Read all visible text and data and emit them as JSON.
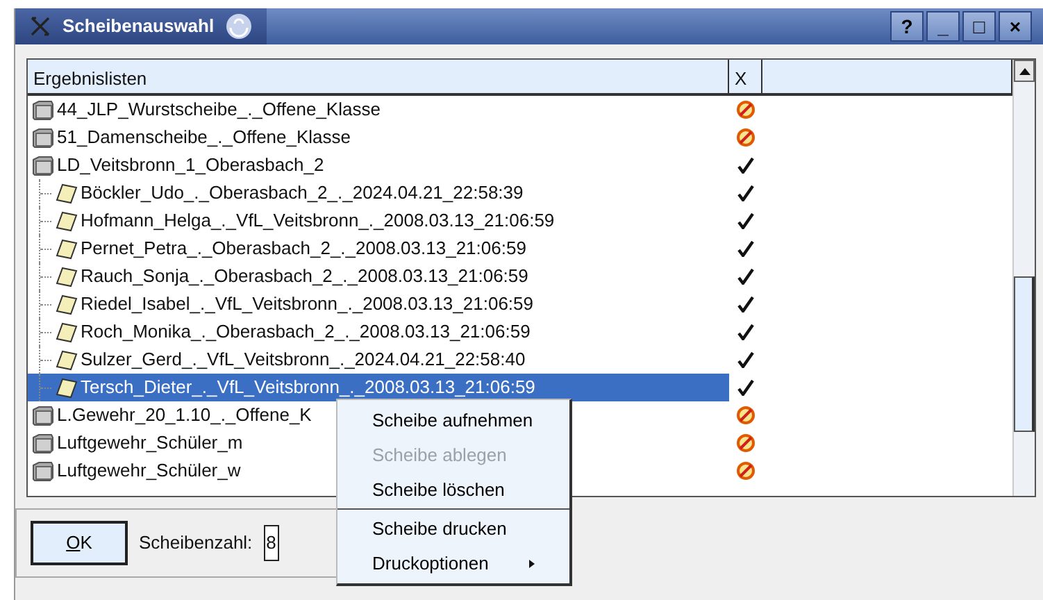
{
  "window": {
    "title": "Scheibenauswahl",
    "buttons": [
      "?",
      "_",
      "□",
      "×"
    ]
  },
  "table": {
    "columns": [
      "Ergebnislisten",
      "X"
    ],
    "rows": [
      {
        "label": "44_JLP_Wurstscheibe_._Offene_Klasse",
        "kind": "folder",
        "passed": false,
        "selected": false
      },
      {
        "label": "51_Damenscheibe_._Offene_Klasse",
        "kind": "folder",
        "passed": false,
        "selected": false
      },
      {
        "label": "LD_Veitsbronn_1_Oberasbach_2",
        "kind": "folder",
        "passed": true,
        "selected": false,
        "children": [
          {
            "label": "Böckler_Udo_._Oberasbach_2_._2024.04.21_22:58:39",
            "kind": "target",
            "passed": true,
            "selected": false
          },
          {
            "label": "Hofmann_Helga_._VfL_Veitsbronn_._2008.03.13_21:06:59",
            "kind": "target",
            "passed": true,
            "selected": false
          },
          {
            "label": "Pernet_Petra_._Oberasbach_2_._2008.03.13_21:06:59",
            "kind": "target",
            "passed": true,
            "selected": false
          },
          {
            "label": "Rauch_Sonja_._Oberasbach_2_._2008.03.13_21:06:59",
            "kind": "target",
            "passed": true,
            "selected": false
          },
          {
            "label": "Riedel_Isabel_._VfL_Veitsbronn_._2008.03.13_21:06:59",
            "kind": "target",
            "passed": true,
            "selected": false
          },
          {
            "label": "Roch_Monika_._Oberasbach_2_._2008.03.13_21:06:59",
            "kind": "target",
            "passed": true,
            "selected": false
          },
          {
            "label": "Sulzer_Gerd_._VfL_Veitsbronn_._2024.04.21_22:58:40",
            "kind": "target",
            "passed": true,
            "selected": false
          },
          {
            "label": "Tersch_Dieter_._VfL_Veitsbronn_._2008.03.13_21:06:59",
            "kind": "target",
            "passed": true,
            "selected": true
          }
        ]
      },
      {
        "label": "L.Gewehr_20_1.10_._Offene_K",
        "kind": "folder",
        "passed": false,
        "selected": false
      },
      {
        "label": "Luftgewehr_Schüler_m",
        "kind": "folder",
        "passed": false,
        "selected": false
      },
      {
        "label": "Luftgewehr_Schüler_w",
        "kind": "folder",
        "passed": false,
        "selected": false
      }
    ]
  },
  "footer": {
    "ok_button": "OK",
    "count_label": "Scheibenzahl:",
    "count_value": "8"
  },
  "context_menu": [
    {
      "kind": "item",
      "label": "Scheibe aufnehmen",
      "disabled": false
    },
    {
      "kind": "item",
      "label": "Scheibe ablegen",
      "disabled": true
    },
    {
      "kind": "item",
      "label": "Scheibe löschen",
      "disabled": false
    },
    {
      "kind": "separator"
    },
    {
      "kind": "item",
      "label": "Scheibe drucken",
      "disabled": false
    },
    {
      "kind": "item",
      "label": "Druckoptionen",
      "disabled": false,
      "submenu": true
    }
  ]
}
